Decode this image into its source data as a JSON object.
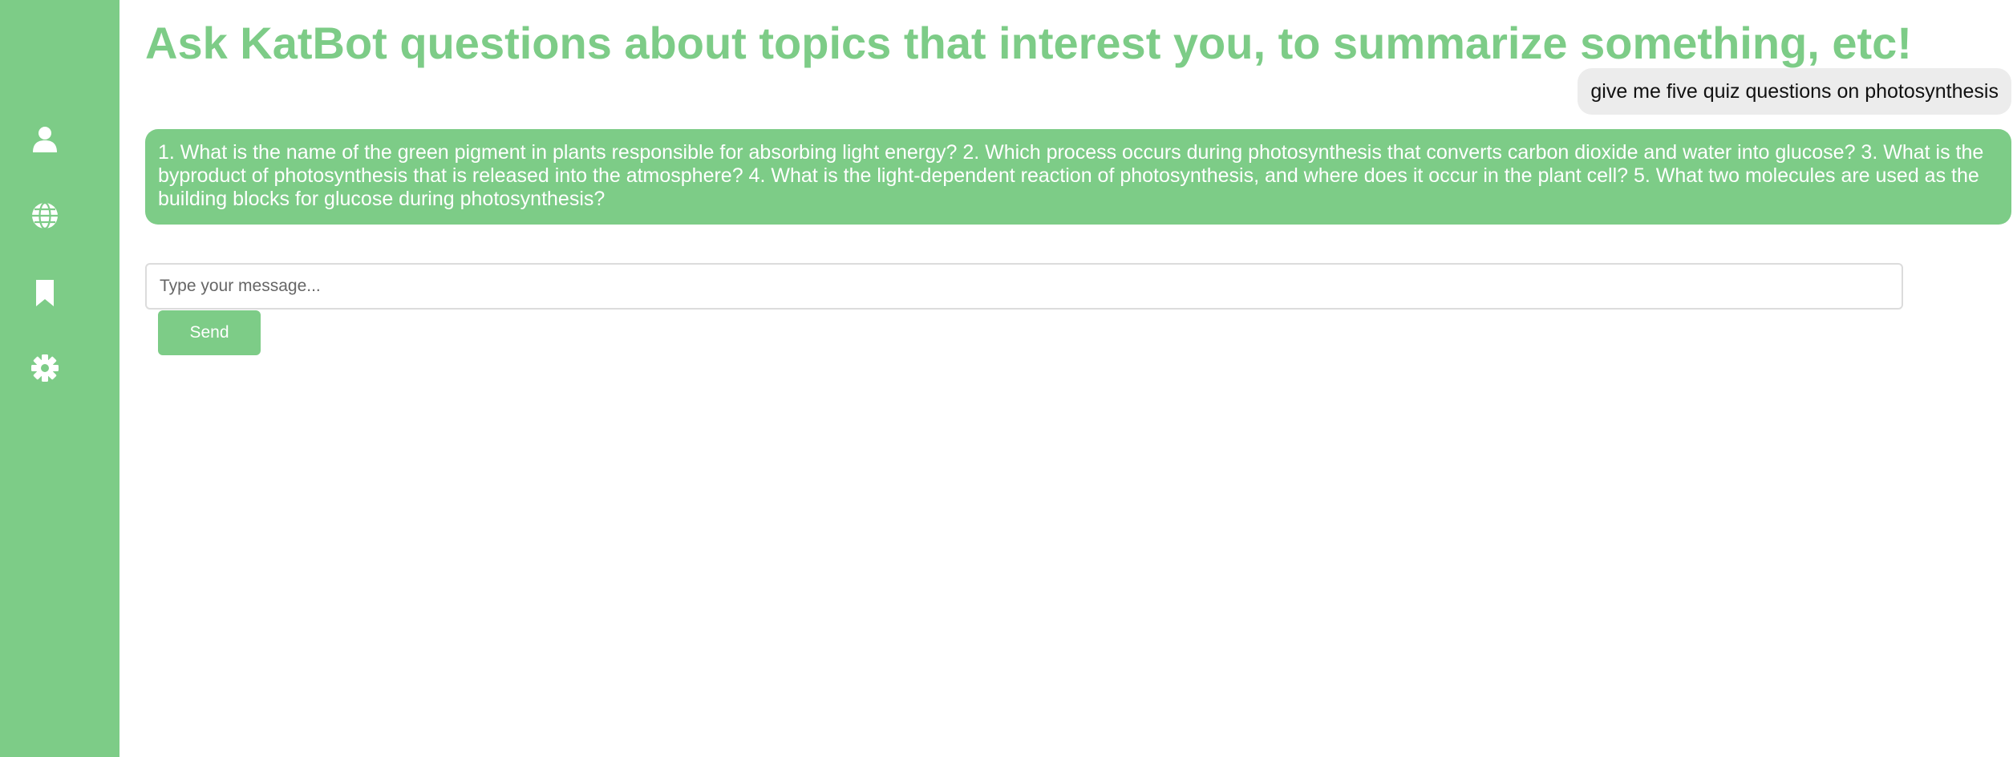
{
  "theme": {
    "accent_color": "#7dcc87",
    "user_bubble_color": "#ececec"
  },
  "sidebar": {
    "items": [
      {
        "icon": "user-icon"
      },
      {
        "icon": "globe-icon"
      },
      {
        "icon": "bookmark-icon"
      },
      {
        "icon": "gear-icon"
      }
    ]
  },
  "header": {
    "title": "Ask KatBot questions about topics that interest you, to summarize something, etc!"
  },
  "chat": {
    "messages": [
      {
        "role": "user",
        "text": "give me five quiz questions on photosynthesis"
      },
      {
        "role": "bot",
        "text": "1. What is the name of the green pigment in plants responsible for absorbing light energy? 2. Which process occurs during photosynthesis that converts carbon dioxide and water into glucose? 3. What is the byproduct of photosynthesis that is released into the atmosphere? 4. What is the light-dependent reaction of photosynthesis, and where does it occur in the plant cell? 5. What two molecules are used as the building blocks for glucose during photosynthesis?"
      }
    ]
  },
  "composer": {
    "value": "",
    "placeholder": "Type your message...",
    "send_label": "Send"
  }
}
